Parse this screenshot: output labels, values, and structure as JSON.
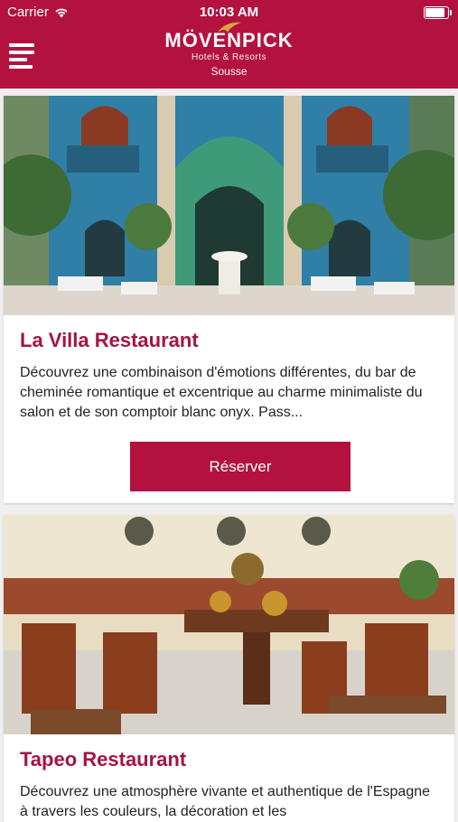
{
  "status_bar": {
    "carrier": "Carrier",
    "time": "10:03 AM"
  },
  "header": {
    "brand_name": "MÖVENPICK",
    "brand_tagline": "Hotels & Resorts",
    "city": "Sousse",
    "brand_color": "#b3123f"
  },
  "restaurants": [
    {
      "title": "La Villa Restaurant",
      "description": "Découvrez une combinaison d'émotions différentes, du bar de cheminée romantique et excentrique au charme minimaliste du salon et de son comptoir blanc onyx. Pass...",
      "button_label": "Réserver"
    },
    {
      "title": "Tapeo Restaurant",
      "description": "Découvrez une atmosphère vivante et authentique de l'Espagne à travers les couleurs, la décoration et les"
    }
  ],
  "icons": {
    "menu": "hamburger-menu-icon",
    "wifi": "wifi-icon",
    "battery": "battery-icon",
    "logo": "wing-logo-icon"
  }
}
